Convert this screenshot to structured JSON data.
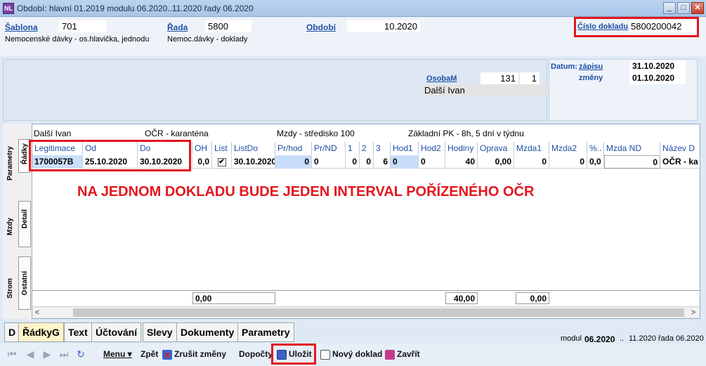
{
  "window": {
    "app_icon_text": "NL",
    "title": "Období: hlavní 01.2019 modulu 06.2020..11.2020 řady 06.2020",
    "min": "_",
    "max": "□",
    "close": "✕"
  },
  "header": {
    "sablona_label": "Šablona",
    "sablona_value": "701",
    "sablona_desc": "Nemocenské dávky - os.hlavička, jednodu",
    "rada_label": "Řada",
    "rada_value": "5800",
    "rada_desc": "Nemoc.dávky - doklady",
    "obdobi_label": "Období",
    "obdobi_value": "10.2020",
    "cislo_label": "Číslo dokladu",
    "cislo_value": "5800200042"
  },
  "person": {
    "osoba_label": "OsobaM",
    "osoba_id": "131",
    "osoba_num": "1",
    "osoba_name": "Další Ivan",
    "datum_label": "Datum:",
    "zapisu_label": "zápisu",
    "zapisu_value": "31.10.2020",
    "zmeny_label": "změny",
    "zmeny_value": "01.10.2020"
  },
  "vtabs": {
    "parametry": "Parametry",
    "radky": "Řádky",
    "mzdy": "Mzdy",
    "detail": "Detail",
    "strom": "Strom",
    "ostatni": "Ostatní"
  },
  "infobar": {
    "name": "Další Ivan",
    "type": "OČR - karanténa",
    "group": "Mzdy - středisko 100",
    "pk": "Základní PK - 8h, 5 dní v týdnu"
  },
  "grid": {
    "headers": [
      "Legitimace",
      "Od",
      "Do",
      "OH",
      "List",
      "ListDo",
      "Pr/hod",
      "Pr/ND",
      "1",
      "2",
      "3",
      "Hod1",
      "Hod2",
      "Hodiny",
      "Oprava",
      "Mzda1",
      "Mzda2",
      "%..",
      "Mzda ND",
      "Název D"
    ],
    "row": {
      "legitimace": "1700057B",
      "od": "25.10.2020",
      "do": "30.10.2020",
      "oh": "0,0",
      "list": "✔",
      "listdo": "30.10.2020",
      "prhod": "0",
      "prnd": "0",
      "c1": "0",
      "c2": "0",
      "c3": "6",
      "hod1": "0",
      "hod2": "0",
      "hodiny": "40",
      "oprava": "0,00",
      "mzda1": "0",
      "mzda2": "0",
      "pct": "0,0",
      "mzdand": "0",
      "nazev": "OČR - ka"
    },
    "sums": {
      "oh": "0,00",
      "hodiny": "40,00",
      "oprava": "0,00"
    }
  },
  "annotation": "NA JEDNOM DOKLADU BUDE JEDEN INTERVAL POŘÍZENÉHO OČR",
  "bottom_tabs": [
    "D",
    "ŘádkyG",
    "Text",
    "Účtování",
    "Slevy",
    "Dokumenty",
    "Parametry"
  ],
  "modul_info": {
    "modul_label": "modul",
    "modul_from": "06.2020",
    "sep": "..",
    "modul_to": "11.2020",
    "rada_label": "řada",
    "rada_value": "06.2020"
  },
  "toolbar": {
    "first": "⏮",
    "prev": "◀",
    "next": "▶",
    "last": "⏭",
    "refresh": "↻",
    "menu": "Menu ▾",
    "zpet": "Zpět",
    "zrusit": "Zrušit změny",
    "dopocty": "Dopočty",
    "ulozit": "Uložit",
    "novy": "Nový doklad",
    "zavrit": "Zavřít"
  }
}
